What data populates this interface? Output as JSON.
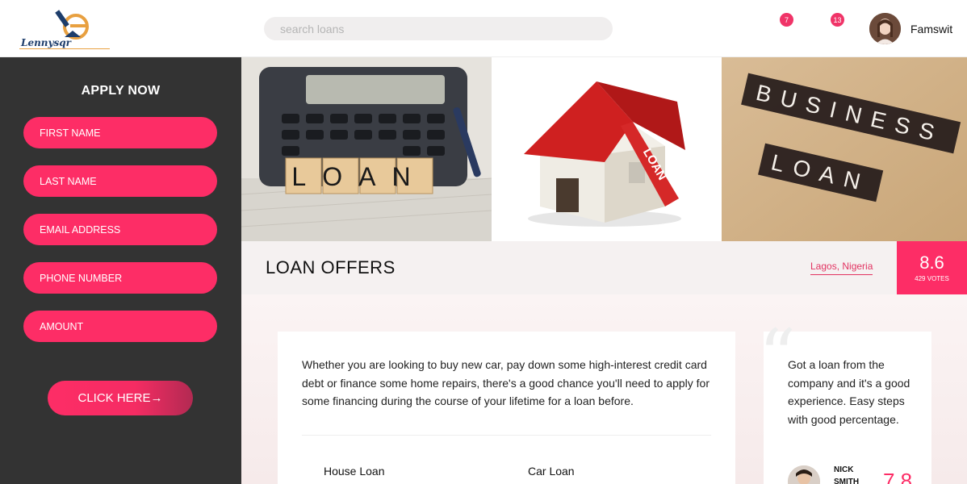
{
  "header": {
    "logo_text": "Lennysqr",
    "search_placeholder": "search loans",
    "notifications": [
      {
        "count": "7"
      },
      {
        "count": "13"
      }
    ],
    "username": "Famswit"
  },
  "sidebar": {
    "title": "APPLY NOW",
    "fields": [
      {
        "label": "FIRST NAME"
      },
      {
        "label": "LAST NAME"
      },
      {
        "label": "EMAIL ADDRESS"
      },
      {
        "label": "PHONE NUMBER"
      },
      {
        "label": "AMOUNT"
      }
    ],
    "cta_label": "CLICK HERE→"
  },
  "banner_images": {
    "img1_text": "LOAN",
    "img2_text": "LOAN",
    "img3_line1": "BUSINESS",
    "img3_line2": "LOAN"
  },
  "offers": {
    "title": "LOAN OFFERS",
    "location": "Lagos, Nigeria",
    "rating": "8.6",
    "votes": "429 VOTES"
  },
  "card": {
    "text": "Whether you are looking to buy new car, pay down some high-interest credit card debt or finance some home repairs, there's a good chance you'll need to apply for some financing during the course of your lifetime for a loan before.",
    "tabs": [
      "House Loan",
      "Car Loan"
    ]
  },
  "testimonial": {
    "quote_mark": "“",
    "text": "Got a loan from the company and it's a good experience. Easy steps with good percentage.",
    "name": "NICK SMITH",
    "score": "7.8"
  },
  "colors": {
    "accent": "#fd2d66",
    "sidebar_bg": "#333333"
  }
}
